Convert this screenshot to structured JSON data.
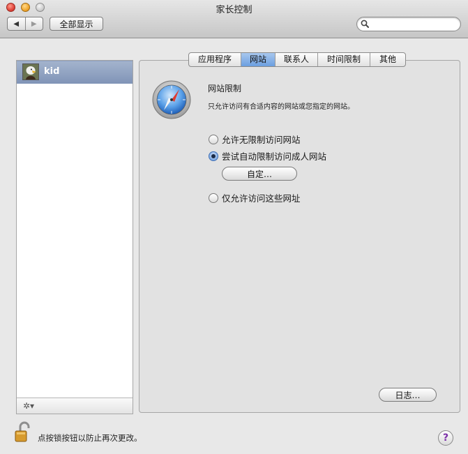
{
  "window": {
    "title": "家长控制"
  },
  "toolbar": {
    "back_icon": "◀",
    "forward_icon": "▶",
    "show_all_label": "全部显示",
    "search_placeholder": ""
  },
  "users": [
    {
      "name": "kid",
      "selected": true
    }
  ],
  "list_footer": {
    "gear_label": "✲▾"
  },
  "tabs": [
    {
      "label": "应用程序",
      "active": false
    },
    {
      "label": "网站",
      "active": true
    },
    {
      "label": "联系人",
      "active": false
    },
    {
      "label": "时间限制",
      "active": false
    },
    {
      "label": "其他",
      "active": false
    }
  ],
  "website": {
    "title": "网站限制",
    "description": "只允许访问有合适内容的网站或您指定的网站。",
    "options": [
      {
        "label": "允许无限制访问网站",
        "selected": false
      },
      {
        "label": "尝试自动限制访问成人网站",
        "selected": true
      },
      {
        "label": "仅允许访问这些网址",
        "selected": false
      }
    ],
    "customize_label": "自定…",
    "logs_label": "日志…"
  },
  "footer": {
    "lock_text": "点按锁按钮以防止再次更改。",
    "help_label": "?"
  },
  "colors": {
    "selection": "#8a9cbd",
    "tab_active": "#7ba8e4",
    "help_accent": "#7b2fa8"
  }
}
